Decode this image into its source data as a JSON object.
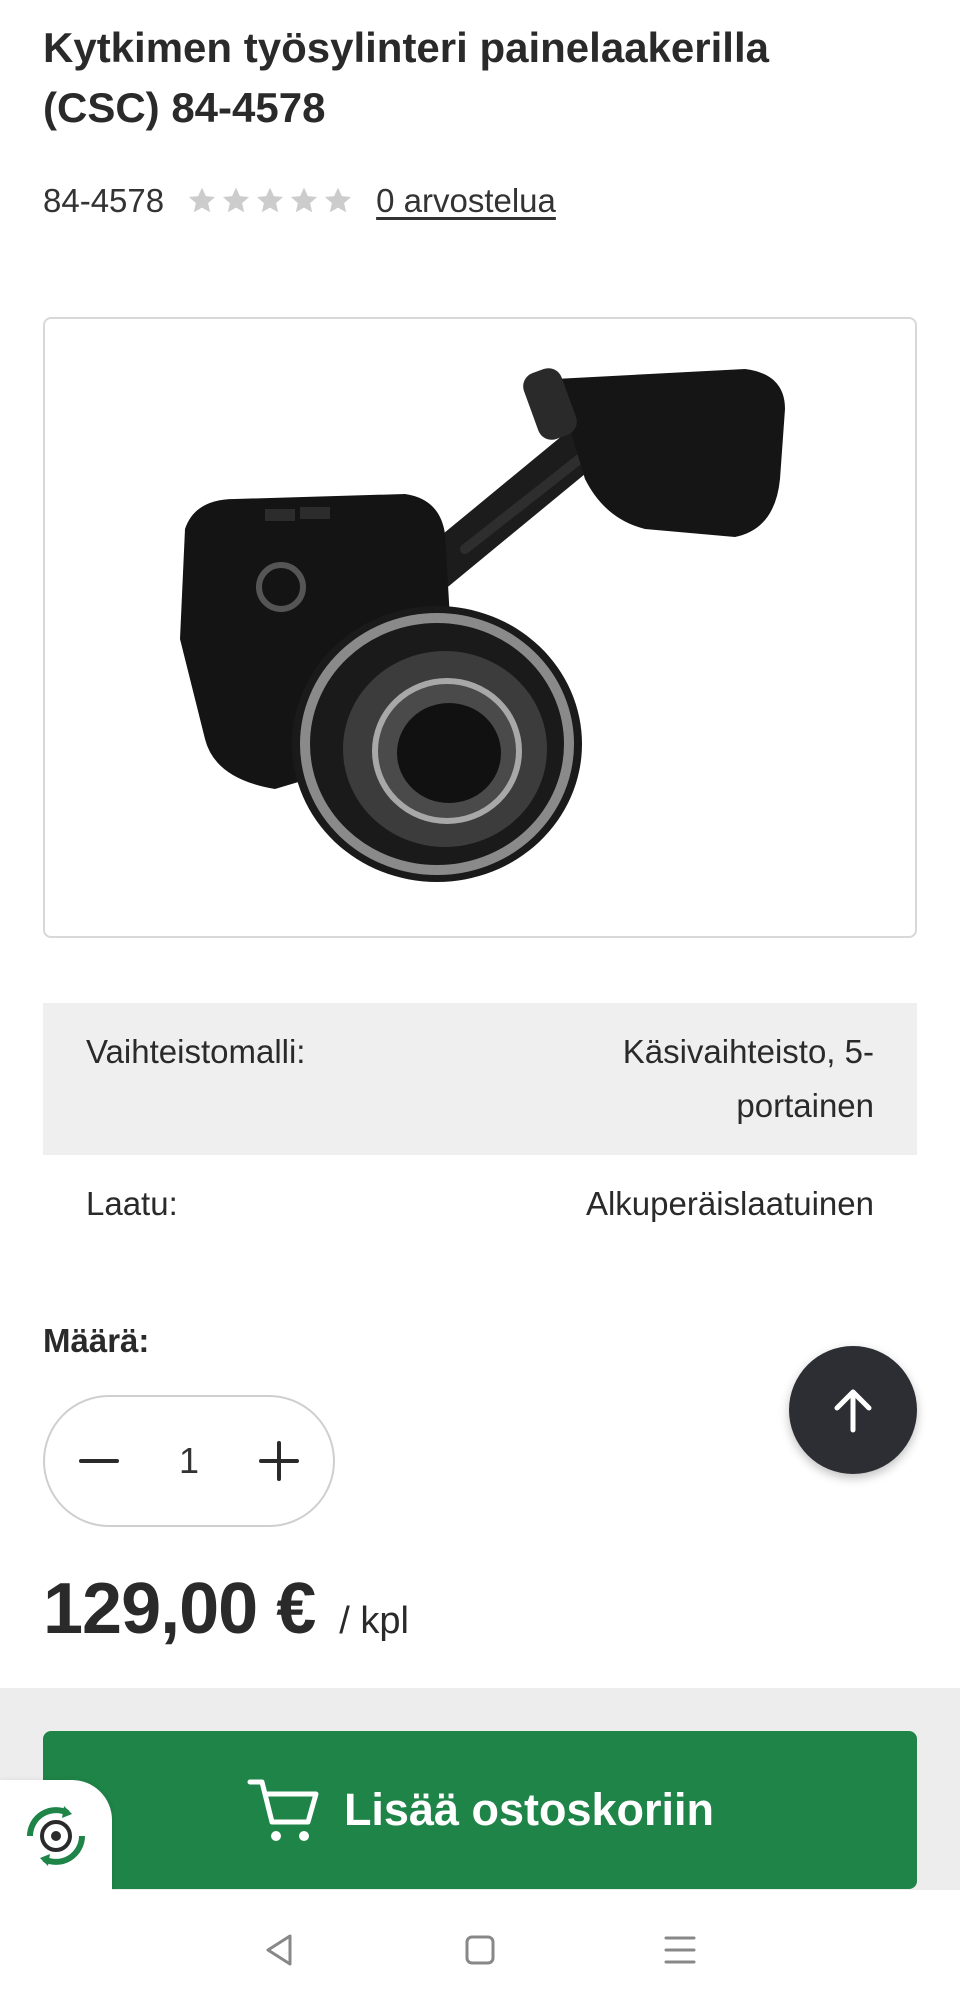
{
  "product": {
    "title": "Kytkimen työsylinteri painelaakerilla (CSC) 84-4578",
    "sku": "84-4578",
    "rating_stars": 0,
    "rating_max": 5,
    "reviews_link": "0 arvostelua"
  },
  "specs": [
    {
      "key": "Vaihteistomalli:",
      "value": "Käsivaihteisto, 5-portainen"
    },
    {
      "key": "Laatu:",
      "value": "Alkuperäislaatuinen"
    }
  ],
  "quantity": {
    "label": "Määrä:",
    "value": "1",
    "minus_icon": "minus-icon",
    "plus_icon": "plus-icon"
  },
  "price": {
    "amount": "129,00 €",
    "unit": "/ kpl"
  },
  "cart": {
    "button_label": "Lisää ostoskoriin",
    "icon": "cart-icon"
  },
  "colors": {
    "accent_green": "#1f8448",
    "scroll_button": "#2d2e33",
    "star_inactive": "#cccccc"
  },
  "nav": {
    "back_icon": "back-triangle-icon",
    "home_icon": "home-square-icon",
    "menu_icon": "menu-lines-icon"
  }
}
